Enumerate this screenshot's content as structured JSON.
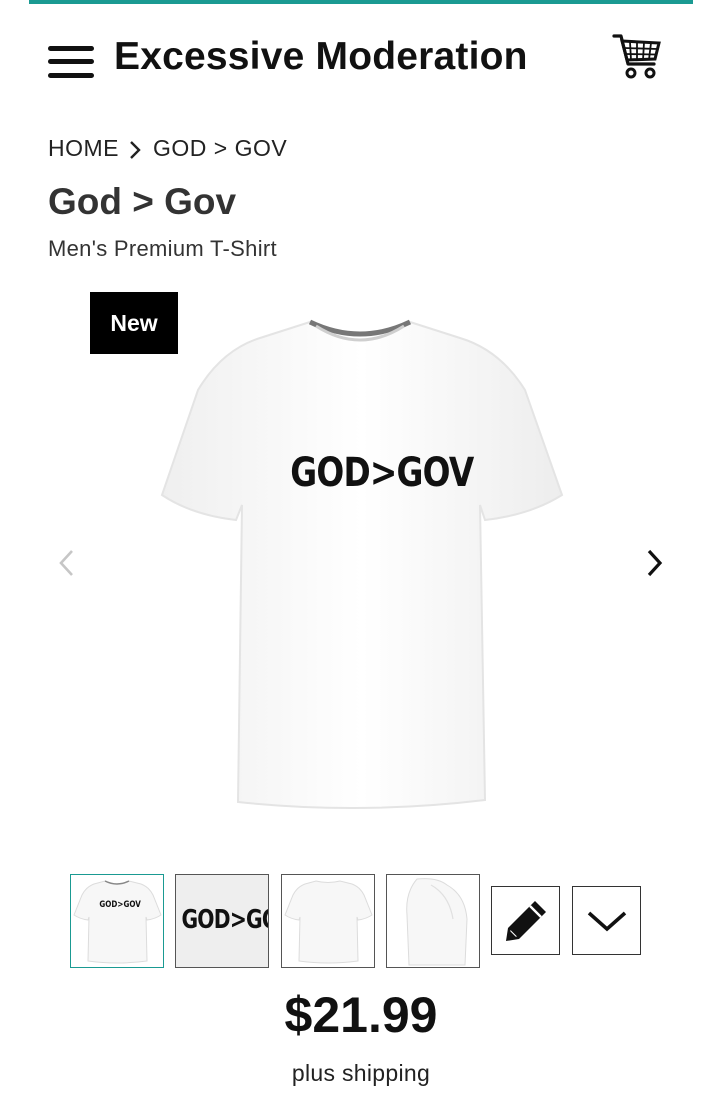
{
  "header": {
    "brand": "Excessive Moderation",
    "accent_color": "#1a9a92",
    "menu_icon": "hamburger-menu-icon",
    "cart_icon": "shopping-cart-icon"
  },
  "breadcrumb": {
    "items": [
      "HOME",
      "GOD > GOV"
    ],
    "separator_icon": "chevron-right-icon"
  },
  "product": {
    "title": "God > Gov",
    "type": "Men's Premium T-Shirt",
    "badge": "New",
    "design_text": "GOD>GOV",
    "price": "$21.99",
    "shipping_note": "plus shipping"
  },
  "gallery": {
    "prev_icon": "chevron-left-icon",
    "next_icon": "chevron-right-icon",
    "thumbnails": [
      {
        "view": "front",
        "active": true
      },
      {
        "view": "design-closeup",
        "active": false
      },
      {
        "view": "back",
        "active": false
      },
      {
        "view": "side",
        "active": false
      }
    ],
    "edit_icon": "pencil-icon",
    "more_icon": "chevron-down-icon"
  }
}
